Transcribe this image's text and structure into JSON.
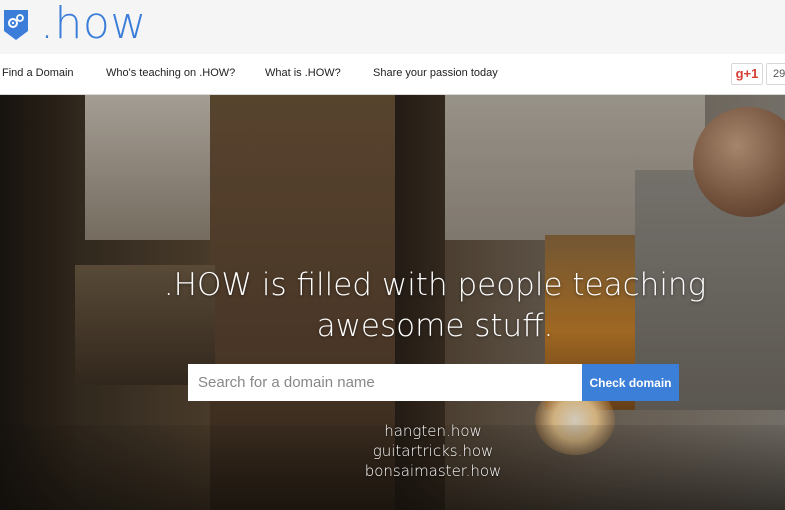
{
  "brand": {
    "logo_text": ".how",
    "logo_icon": "gears-badge-icon",
    "color": "#3b7dd8"
  },
  "nav": {
    "items": [
      {
        "label": "Find a Domain"
      },
      {
        "label": "Who's teaching on .HOW?"
      },
      {
        "label": "What is .HOW?"
      },
      {
        "label": "Share your passion today"
      }
    ],
    "gplus_label": "g+1",
    "gplus_count": "29"
  },
  "hero": {
    "heading_line1": ".HOW is filled with people teaching",
    "heading_line2": "awesome stuff.",
    "search_placeholder": "Search for a domain name",
    "button_label": "Check domain",
    "button_color": "#3c7fd9",
    "examples": [
      "hangten.how",
      "guitartricks.how",
      "bonsaimaster.how"
    ]
  }
}
